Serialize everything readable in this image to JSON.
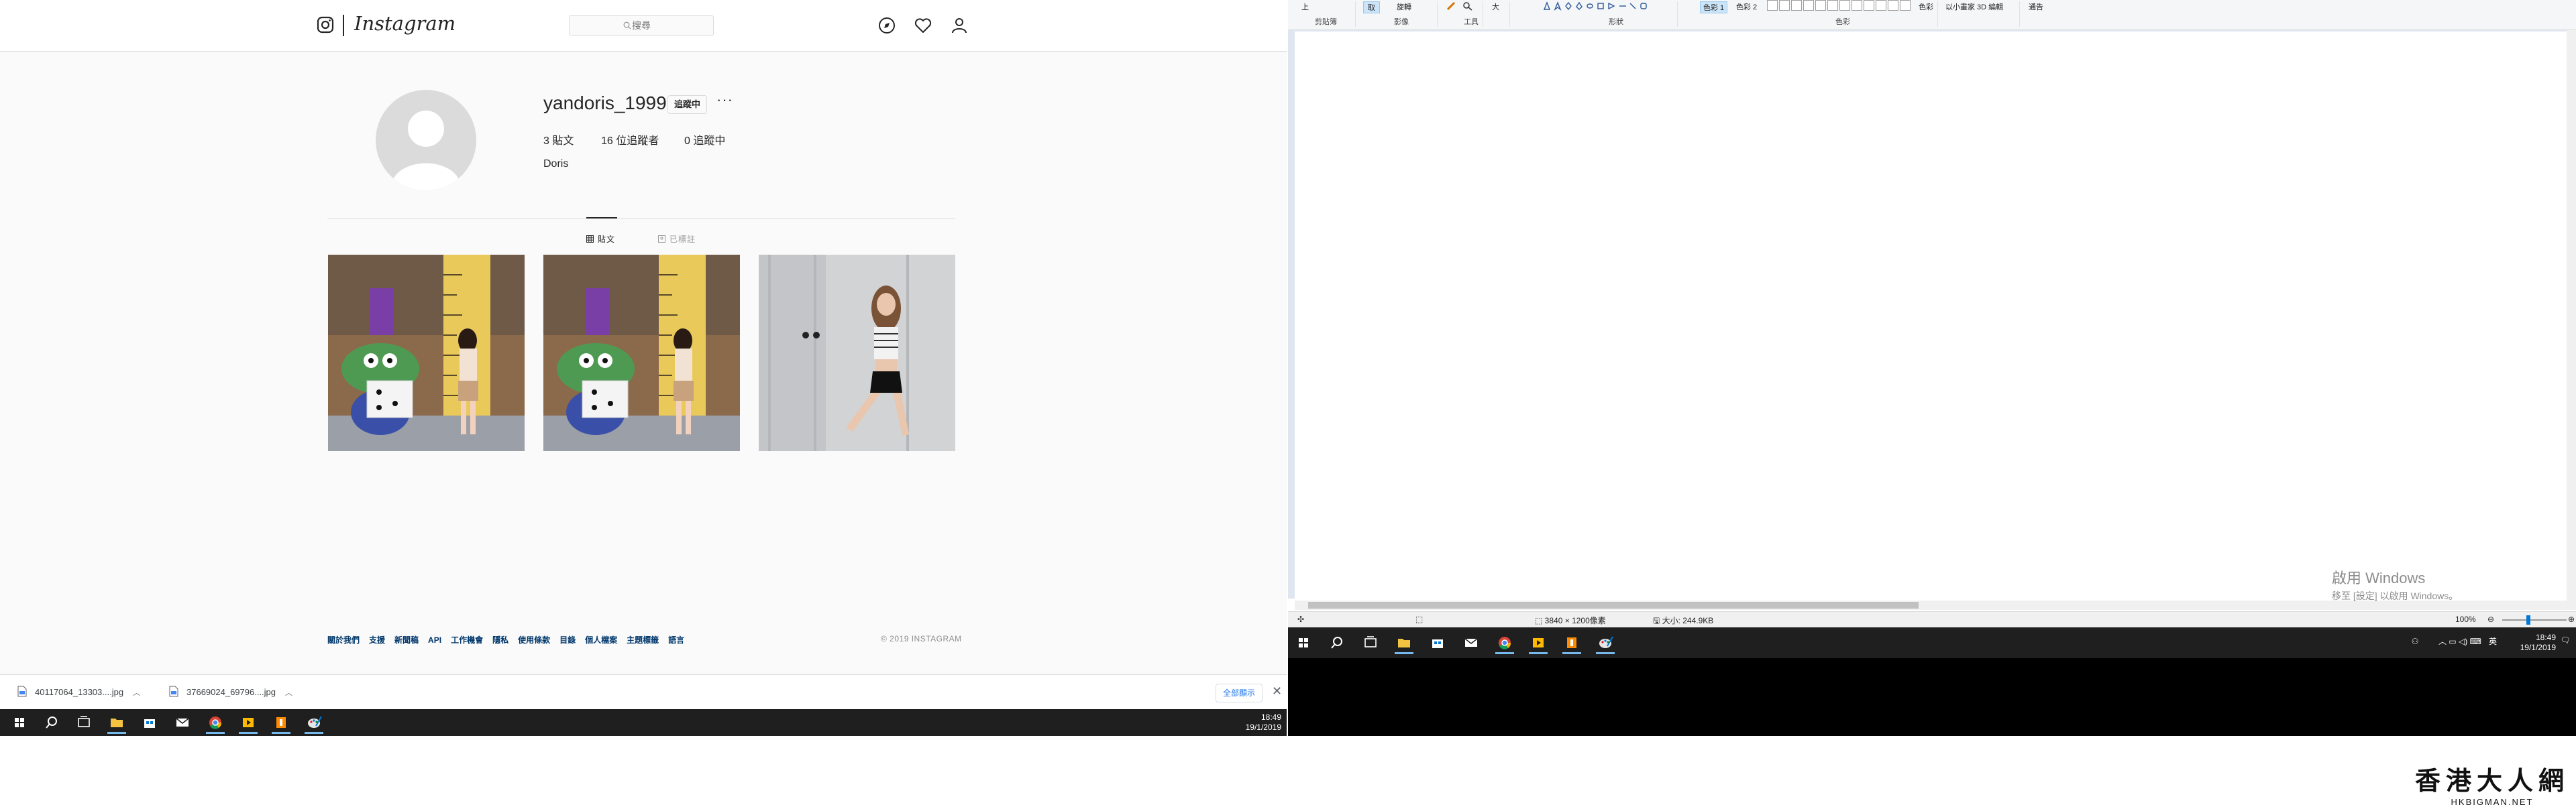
{
  "instagram": {
    "wordmark": "Instagram",
    "search_placeholder": "搜尋",
    "profile": {
      "username": "yandoris_1999",
      "follow_button": "追蹤中",
      "more": "···",
      "stats": {
        "posts": "3 貼文",
        "followers": "16 位追蹤者",
        "following": "0 追蹤中"
      },
      "full_name": "Doris"
    },
    "tabs": {
      "posts": "貼文",
      "tagged": "已標註"
    },
    "footer_links": [
      "關於我們",
      "支援",
      "新聞稿",
      "API",
      "工作機會",
      "隱私",
      "使用條款",
      "目錄",
      "個人檔案",
      "主題標籤",
      "語言"
    ],
    "copyright": "© 2019 INSTAGRAM"
  },
  "downloads": {
    "items": [
      {
        "name": "40117064_13303....jpg"
      },
      {
        "name": "37669024_69796....jpg"
      }
    ],
    "show_all": "全部顯示",
    "close": "✕"
  },
  "left_taskbar": {
    "time": "18:49",
    "date": "19/1/2019"
  },
  "paint": {
    "ribbon_groups": {
      "clipboard": "剪貼簿",
      "image": "影像",
      "tools": "工具",
      "shapes": "形狀",
      "colors": "色彩"
    },
    "ribbon_items": {
      "paste": "上",
      "select": "取",
      "rotate": "旋轉",
      "size": "大",
      "color1": "色彩 1",
      "color2": "色彩 2",
      "edit_colors": "色彩",
      "paint3d": "以小畫家 3D 編輯",
      "alert": "通告"
    },
    "status": {
      "dimensions": "3840 × 1200像素",
      "size": "大小: 244.9KB",
      "zoom": "100%"
    },
    "watermark": {
      "line1": "啟用 Windows",
      "line2": "移至 [設定] 以啟用 Windows。"
    }
  },
  "right_taskbar": {
    "time": "18:49",
    "date": "19/1/2019",
    "ime": "英"
  },
  "branding": {
    "line1": "香港大人網",
    "line2": "HKBIGMAN.NET"
  },
  "colors": {
    "ig_border": "#dbdbdb",
    "ig_link": "#00376b",
    "taskbar": "#1f1f1f",
    "accent": "#0078d7"
  }
}
